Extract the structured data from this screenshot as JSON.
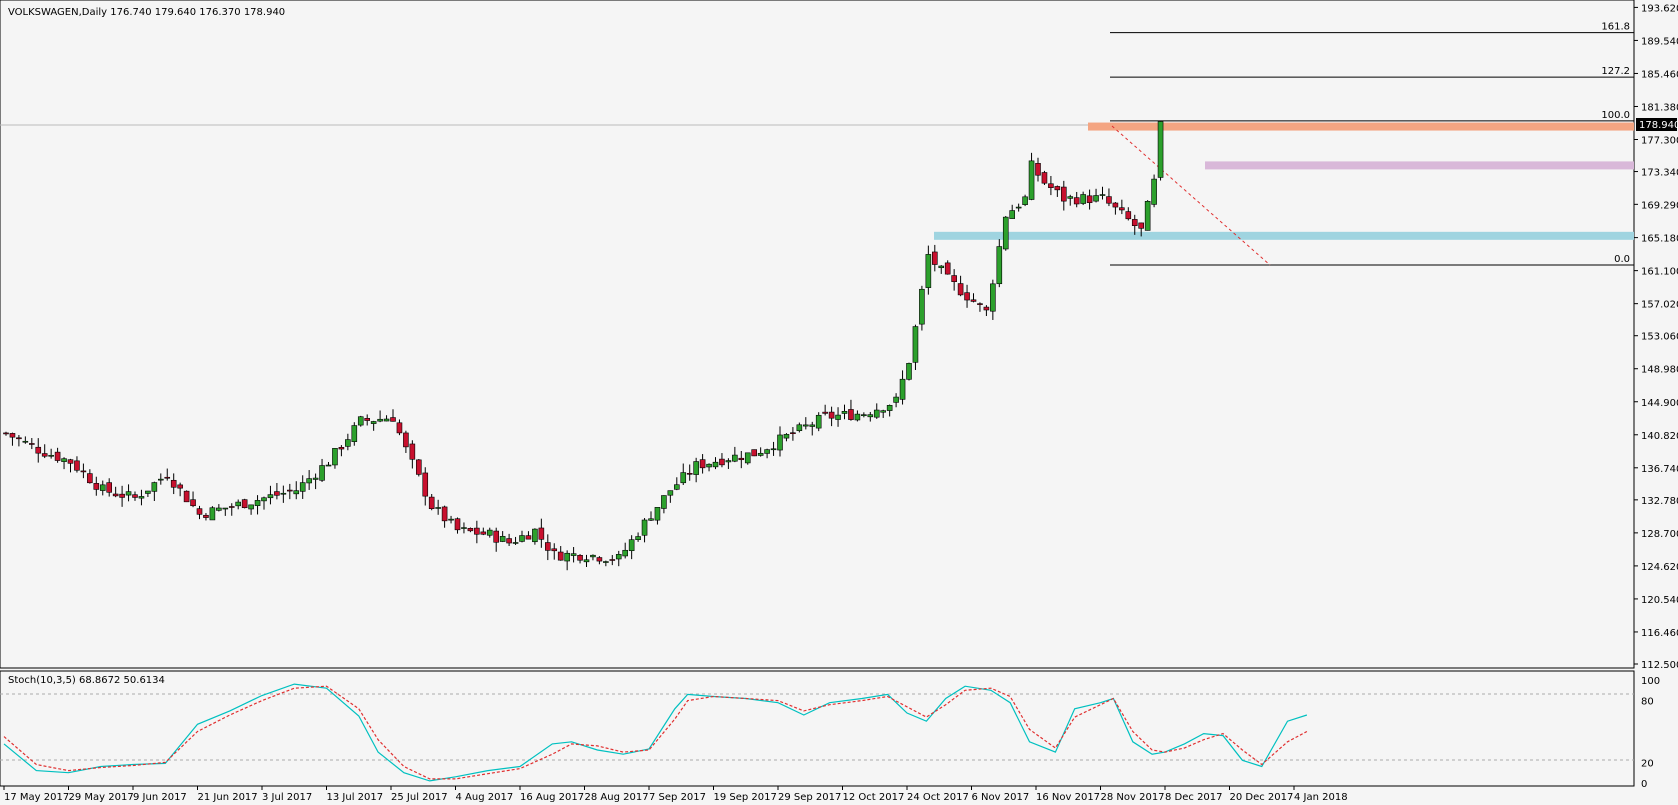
{
  "chart_data": [
    {
      "type": "candlestick",
      "header": "VOLKSWAGEN,Daily  176.740 179.640 176.370 178.940",
      "symbol": "VOLKSWAGEN",
      "timeframe": "Daily",
      "last_price": "178.940",
      "ylim": [
        112.5,
        193.3
      ],
      "y_ticks": [
        "193.620",
        "189.540",
        "185.460",
        "181.380",
        "177.300",
        "173.340",
        "169.290",
        "165.180",
        "161.100",
        "157.020",
        "153.060",
        "148.980",
        "144.900",
        "140.820",
        "136.740",
        "132.780",
        "128.700",
        "124.620",
        "120.540",
        "116.460",
        "112.500"
      ],
      "x_ticks": [
        "17 May 2017",
        "29 May 2017",
        "9 Jun 2017",
        "21 Jun 2017",
        "3 Jul 2017",
        "13 Jul 2017",
        "25 Jul 2017",
        "4 Aug 2017",
        "16 Aug 2017",
        "28 Aug 2017",
        "7 Sep 2017",
        "19 Sep 2017",
        "29 Sep 2017",
        "12 Oct 2017",
        "24 Oct 2017",
        "6 Nov 2017",
        "16 Nov 2017",
        "28 Nov 2017",
        "8 Dec 2017",
        "20 Dec 2017",
        "4 Jan 2018"
      ],
      "close_path": [
        [
          0,
          141
        ],
        [
          5,
          139
        ],
        [
          10,
          137.5
        ],
        [
          15,
          134
        ],
        [
          20,
          133
        ],
        [
          25,
          136
        ],
        [
          30,
          131
        ],
        [
          35,
          132
        ],
        [
          40,
          133
        ],
        [
          45,
          134
        ],
        [
          50,
          137.5
        ],
        [
          55,
          142.5
        ],
        [
          60,
          143
        ],
        [
          62,
          139
        ],
        [
          66,
          132
        ],
        [
          70,
          129
        ],
        [
          75,
          128.5
        ],
        [
          78,
          127.5
        ],
        [
          82,
          129
        ],
        [
          85,
          126
        ],
        [
          90,
          126
        ],
        [
          95,
          125.5
        ],
        [
          100,
          131
        ],
        [
          103,
          134
        ],
        [
          107,
          137
        ],
        [
          112,
          138
        ],
        [
          116,
          138.5
        ],
        [
          122,
          141
        ],
        [
          127,
          143
        ],
        [
          133,
          143.5
        ],
        [
          138,
          145
        ],
        [
          140,
          150
        ],
        [
          141,
          154
        ],
        [
          143,
          163
        ],
        [
          146,
          160
        ],
        [
          149,
          158
        ],
        [
          152,
          156
        ],
        [
          154,
          164
        ],
        [
          155,
          168
        ],
        [
          158,
          170
        ],
        [
          159,
          174
        ],
        [
          161,
          172
        ],
        [
          164,
          170
        ],
        [
          167,
          170
        ],
        [
          170,
          170
        ],
        [
          173,
          168
        ],
        [
          176,
          166
        ],
        [
          177,
          169
        ],
        [
          178,
          172
        ],
        [
          179,
          178.9
        ]
      ],
      "fib_levels": [
        {
          "label": "161.8",
          "value": 190.5
        },
        {
          "label": "127.2",
          "value": 185.0
        },
        {
          "label": "100.0",
          "value": 179.6
        },
        {
          "label": "0.0",
          "value": 161.8
        }
      ],
      "zones": [
        {
          "name": "resistance-zone",
          "value": 178.9,
          "color": "#f4a582"
        },
        {
          "name": "mid-zone",
          "value": 174.1,
          "color": "#d9b8d9"
        },
        {
          "name": "support-zone",
          "value": 165.4,
          "color": "#9fd4e0"
        }
      ],
      "colors": {
        "up": "#2ca02c",
        "down": "#c8102e",
        "bg": "#f5f5f5"
      }
    },
    {
      "type": "line",
      "header": "Stoch(10,3,5) 68.8672 50.6134",
      "ylim": [
        0,
        100
      ],
      "y_ticks": [
        "100",
        "80",
        "20",
        "0"
      ],
      "levels": [
        80,
        20
      ],
      "series": [
        {
          "points": [
            [
              0,
              38
            ],
            [
              5,
              12
            ],
            [
              10,
              10
            ],
            [
              15,
              16
            ],
            [
              20,
              18
            ],
            [
              25,
              19
            ],
            [
              30,
              57
            ],
            [
              35,
              70
            ],
            [
              40,
              85
            ],
            [
              45,
              96
            ],
            [
              50,
              92
            ],
            [
              55,
              65
            ],
            [
              58,
              30
            ],
            [
              62,
              10
            ],
            [
              66,
              2
            ],
            [
              70,
              6
            ],
            [
              75,
              12
            ],
            [
              80,
              16
            ],
            [
              85,
              38
            ],
            [
              88,
              40
            ],
            [
              92,
              32
            ],
            [
              96,
              28
            ],
            [
              100,
              33
            ],
            [
              104,
              72
            ],
            [
              106,
              86
            ],
            [
              110,
              84
            ],
            [
              115,
              82
            ],
            [
              120,
              78
            ],
            [
              124,
              66
            ],
            [
              128,
              78
            ],
            [
              133,
              82
            ],
            [
              137,
              86
            ],
            [
              140,
              68
            ],
            [
              143,
              60
            ],
            [
              146,
              82
            ],
            [
              149,
              94
            ],
            [
              153,
              90
            ],
            [
              156,
              78
            ],
            [
              159,
              40
            ],
            [
              163,
              30
            ],
            [
              166,
              72
            ],
            [
              170,
              78
            ],
            [
              172,
              82
            ],
            [
              175,
              40
            ],
            [
              178,
              28
            ],
            [
              180,
              30
            ],
            [
              183,
              38
            ],
            [
              186,
              48
            ],
            [
              189,
              46
            ],
            [
              192,
              22
            ],
            [
              195,
              16
            ],
            [
              199,
              60
            ],
            [
              202,
              66
            ]
          ],
          "color": "#00c0c0"
        },
        {
          "points": [
            [
              0,
              45
            ],
            [
              5,
              18
            ],
            [
              10,
              12
            ],
            [
              15,
              15
            ],
            [
              20,
              17
            ],
            [
              25,
              20
            ],
            [
              30,
              50
            ],
            [
              35,
              66
            ],
            [
              40,
              80
            ],
            [
              45,
              92
            ],
            [
              50,
              94
            ],
            [
              55,
              72
            ],
            [
              58,
              42
            ],
            [
              62,
              16
            ],
            [
              66,
              4
            ],
            [
              70,
              4
            ],
            [
              75,
              9
            ],
            [
              80,
              14
            ],
            [
              85,
              28
            ],
            [
              88,
              38
            ],
            [
              92,
              36
            ],
            [
              96,
              30
            ],
            [
              100,
              32
            ],
            [
              104,
              62
            ],
            [
              106,
              80
            ],
            [
              110,
              84
            ],
            [
              115,
              82
            ],
            [
              120,
              80
            ],
            [
              124,
              70
            ],
            [
              128,
              76
            ],
            [
              133,
              80
            ],
            [
              137,
              84
            ],
            [
              140,
              74
            ],
            [
              143,
              64
            ],
            [
              146,
              76
            ],
            [
              149,
              90
            ],
            [
              153,
              92
            ],
            [
              156,
              84
            ],
            [
              159,
              52
            ],
            [
              163,
              34
            ],
            [
              166,
              64
            ],
            [
              170,
              76
            ],
            [
              172,
              82
            ],
            [
              175,
              50
            ],
            [
              178,
              32
            ],
            [
              180,
              30
            ],
            [
              183,
              34
            ],
            [
              186,
              42
            ],
            [
              189,
              48
            ],
            [
              192,
              32
            ],
            [
              195,
              18
            ],
            [
              199,
              40
            ],
            [
              202,
              50
            ]
          ],
          "color": "#e03030",
          "dashed": true
        }
      ]
    }
  ]
}
